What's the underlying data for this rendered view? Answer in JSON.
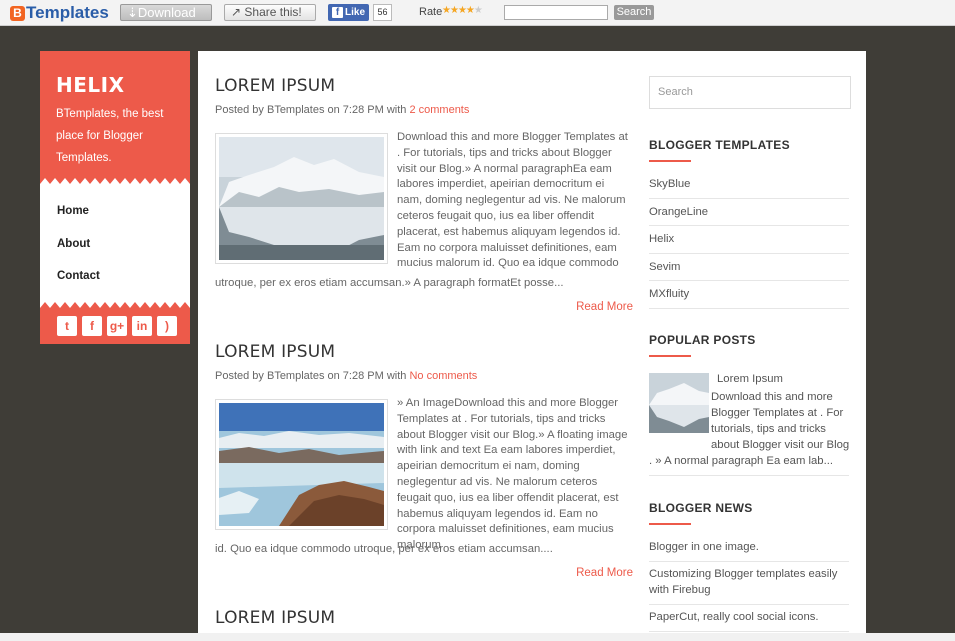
{
  "topbar": {
    "brand_letter": "B",
    "brand_text": "Templates",
    "download_label": "⇣Download",
    "share_label": "↗ Share this!",
    "like_label": "Like",
    "like_count": "56",
    "rate_label": "Rate",
    "rating": 4,
    "search_button": "Search"
  },
  "blog": {
    "title": "HELIX",
    "description": "BTemplates, the best place for Blogger Templates."
  },
  "nav": [
    "Home",
    "About",
    "Contact"
  ],
  "social_icons": [
    "twitter-icon",
    "facebook-icon",
    "google-plus-icon",
    "linkedin-icon",
    "rss-icon"
  ],
  "posts": [
    {
      "title": "LOREM IPSUM",
      "meta_prefix": "Posted by BTemplates on 7:28 PM with",
      "comments": "2 comments",
      "excerpt_side": "Download this and more Blogger Templates at . For tutorials, tips and tricks about Blogger visit our Blog.» A normal paragraphEa eam labores imperdiet, apeirian democritum ei nam, doming neglegentur ad vis. Ne malorum ceteros feugait quo, ius ea liber offendit placerat, est habemus aliquyam legendos id. Eam no corpora maluisset definitiones, eam mucius malorum id. Quo ea idque commodo",
      "excerpt_full": "utroque, per ex eros etiam accumsan.» A paragraph formatEt posse...",
      "read_more": "Read More"
    },
    {
      "title": "LOREM IPSUM",
      "meta_prefix": "Posted by BTemplates on 7:28 PM with",
      "comments": "No comments",
      "excerpt_side": "» An ImageDownload this and more Blogger Templates at . For tutorials, tips and tricks about Blogger visit our Blog.» A floating image with link and text Ea eam labores imperdiet, apeirian democritum ei nam, doming neglegentur ad vis. Ne malorum ceteros feugait quo, ius ea liber offendit placerat, est habemus aliquyam legendos id. Eam no corpora maluisset definitiones, eam mucius malorum",
      "excerpt_full": "id. Quo ea idque commodo utroque, per ex eros etiam accumsan....",
      "read_more": "Read More"
    },
    {
      "title": "LOREM IPSUM"
    }
  ],
  "sidebar": {
    "search_placeholder": "Search",
    "templates_title": "BLOGGER TEMPLATES",
    "templates": [
      "SkyBlue",
      "OrangeLine",
      "Helix",
      "Sevim",
      "MXfluity"
    ],
    "popular_title": "POPULAR POSTS",
    "popular_post_title": "Lorem Ipsum",
    "popular_post_text": "Download this and more Blogger Templates at . For tutorials, tips and tricks about Blogger visit our Blog . » A normal paragraph Ea eam lab...",
    "news_title": "BLOGGER NEWS",
    "news": [
      "Blogger in one image.",
      "Customizing Blogger templates easily with Firebug",
      "PaperCut, really cool social icons."
    ]
  },
  "colors": {
    "accent": "#ed5a4a",
    "page_bg": "#3f3d37",
    "brand_blue": "#2a5da8"
  }
}
